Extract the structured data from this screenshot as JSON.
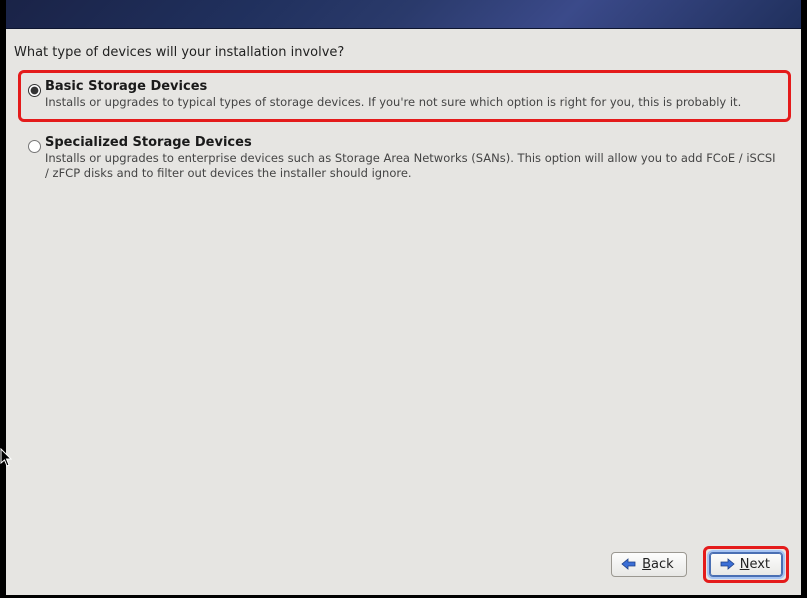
{
  "question": "What type of devices will your installation involve?",
  "options": {
    "basic": {
      "title": "Basic Storage Devices",
      "desc": "Installs or upgrades to typical types of storage devices.  If you're not sure which option is right for you, this is probably it.",
      "selected": true,
      "highlighted": true
    },
    "specialized": {
      "title": "Specialized Storage Devices",
      "desc": "Installs or upgrades to enterprise devices such as Storage Area Networks (SANs). This option will allow you to add FCoE / iSCSI / zFCP disks and to filter out devices the installer should ignore.",
      "selected": false,
      "highlighted": false
    }
  },
  "buttons": {
    "back": {
      "label": "Back",
      "highlighted": false
    },
    "next": {
      "label": "Next",
      "highlighted": true
    }
  }
}
